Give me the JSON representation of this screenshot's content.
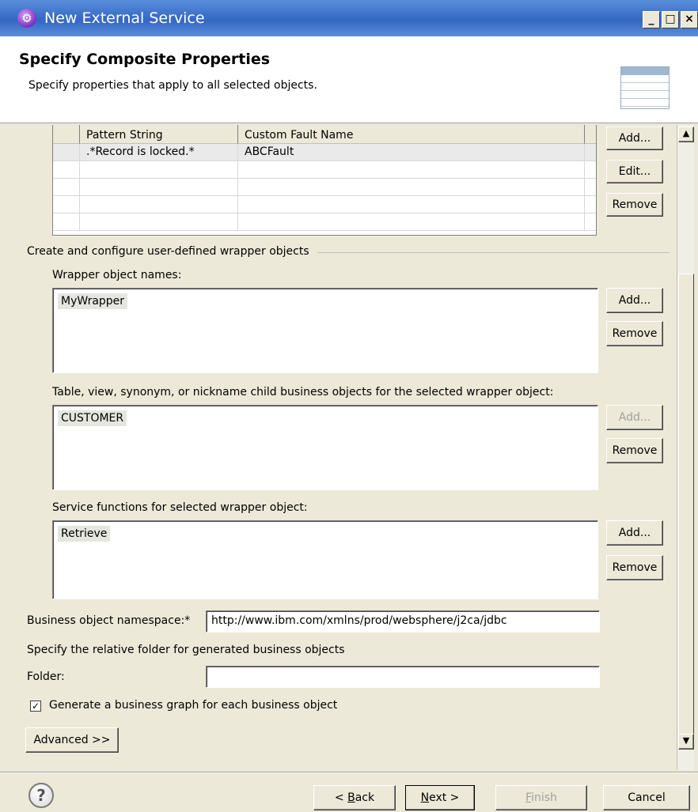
{
  "window": {
    "title": "New External Service",
    "controls": {
      "minimize": "_",
      "maximize": "□",
      "close": "×"
    }
  },
  "header": {
    "title": "Specify Composite Properties",
    "description": "Specify properties that apply to all selected objects.",
    "icon": "table-wizard-icon"
  },
  "fault_table": {
    "columns": [
      "Pattern String",
      "Custom Fault Name"
    ],
    "rows": [
      {
        "pattern": ".*Record is locked.*",
        "fault": "ABCFault"
      }
    ],
    "buttons": {
      "add": "Add...",
      "edit": "Edit...",
      "remove": "Remove"
    }
  },
  "wrapper_group": {
    "title": "Create and configure user-defined wrapper objects",
    "wrapper_names": {
      "label": "Wrapper object names:",
      "items": [
        "MyWrapper"
      ],
      "add": "Add...",
      "remove": "Remove"
    },
    "child_objects": {
      "label": "Table, view, synonym, or nickname child business objects for the selected wrapper object:",
      "items": [
        "CUSTOMER"
      ],
      "add": "Add...",
      "remove": "Remove"
    },
    "service_functions": {
      "label": "Service functions for selected wrapper object:",
      "items": [
        "Retrieve"
      ],
      "add": "Add...",
      "remove": "Remove"
    }
  },
  "namespace": {
    "label": "Business object namespace:*",
    "value": "http://www.ibm.com/xmlns/prod/websphere/j2ca/jdbc"
  },
  "folder": {
    "instruction": "Specify the relative folder for generated business objects",
    "label": "Folder:",
    "value": ""
  },
  "generate_graph": {
    "label": "Generate a business graph for each business object",
    "checked": true
  },
  "advanced_button": "Advanced >>",
  "footer": {
    "back": {
      "prefix": "< ",
      "mnemonic": "B",
      "rest": "ack"
    },
    "next": {
      "mnemonic": "N",
      "rest": "ext >"
    },
    "finish": {
      "mnemonic": "F",
      "rest": "inish"
    },
    "cancel": "Cancel"
  },
  "colors": {
    "titlebar": "#3a6fc8",
    "dialog_bg": "#ece9d8",
    "header_bg": "#ffffff"
  }
}
